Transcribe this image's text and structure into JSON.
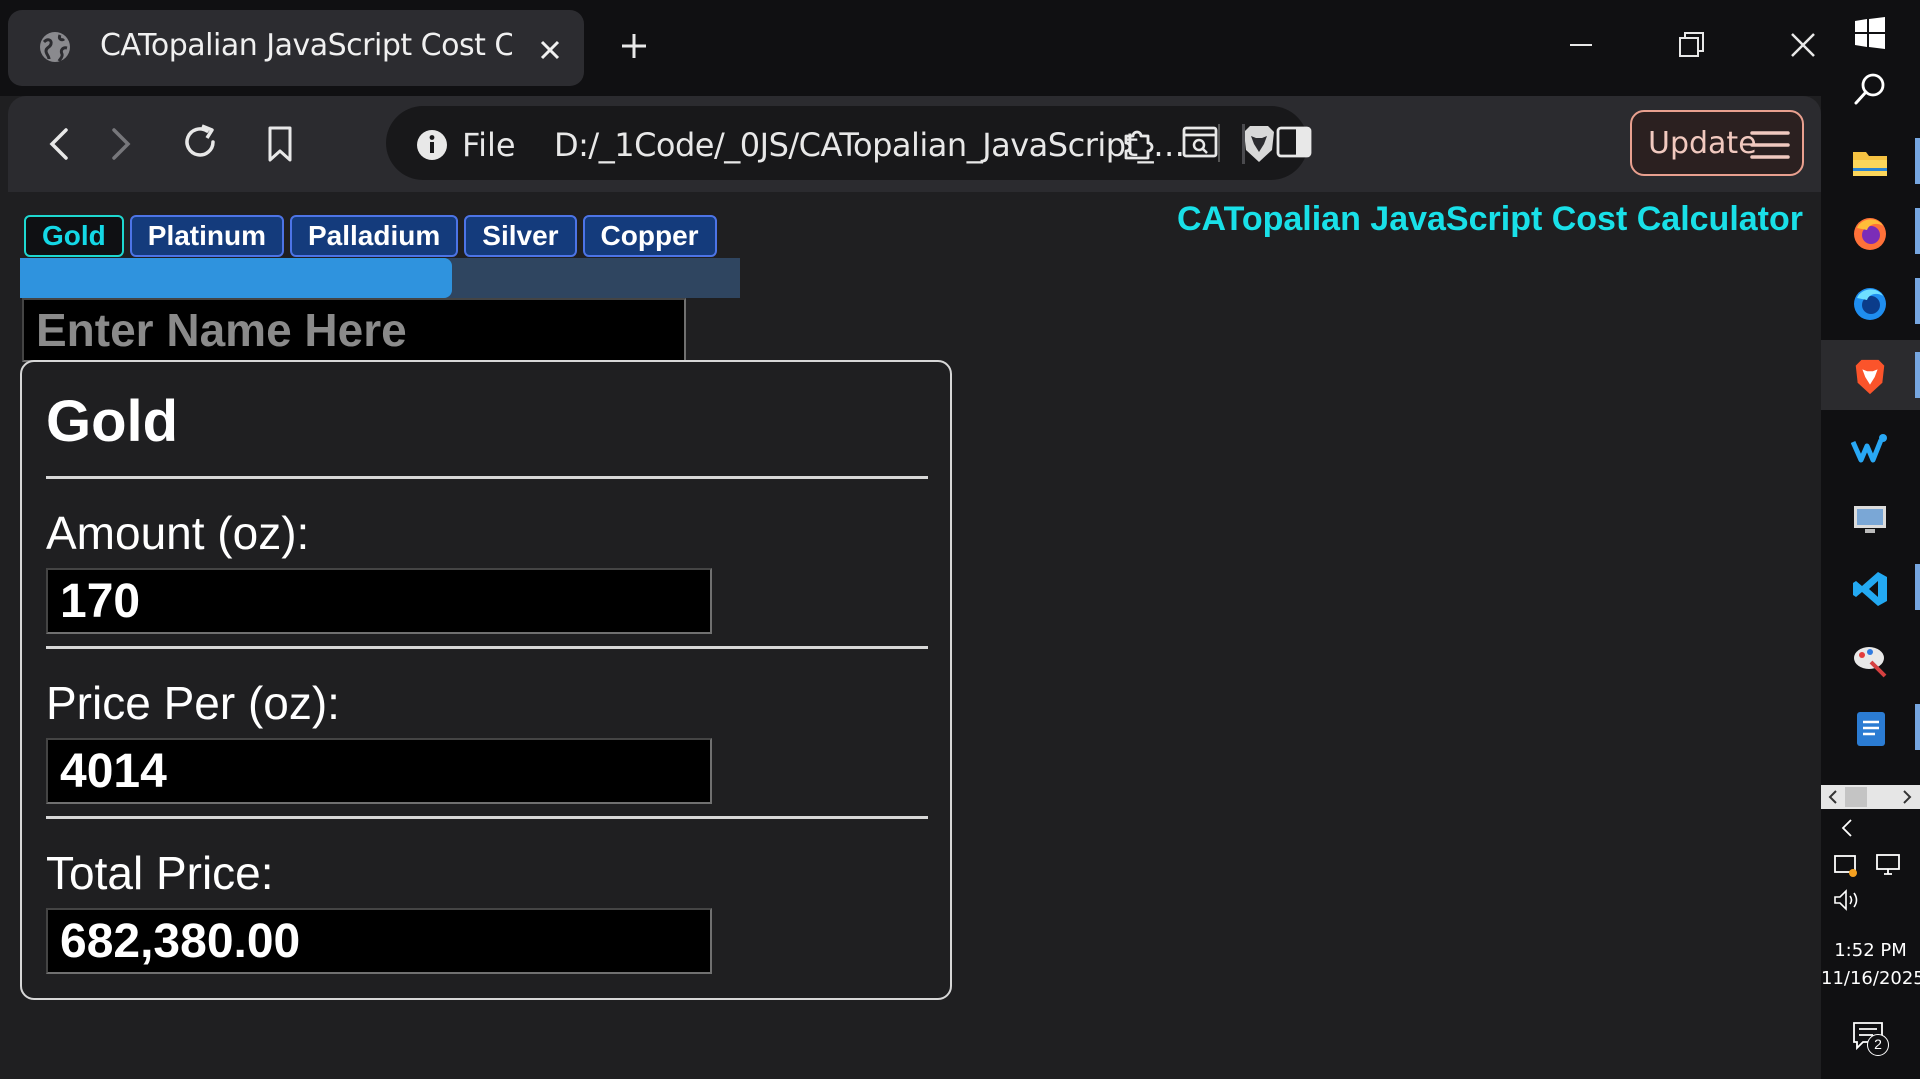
{
  "browser": {
    "tab_title": "CATopalian JavaScript Cost Calcu",
    "address_scheme": "File",
    "address_url": "D:/_1Code/_0JS/CATopalian_JavaScript_C...",
    "update_label": "Update"
  },
  "page": {
    "app_title": "CATopalian JavaScript Cost Calculator",
    "metal_tabs": [
      {
        "label": "Gold",
        "active": true
      },
      {
        "label": "Platinum",
        "active": false
      },
      {
        "label": "Palladium",
        "active": false
      },
      {
        "label": "Silver",
        "active": false
      },
      {
        "label": "Copper",
        "active": false
      }
    ],
    "progress_fraction": 0.6,
    "name_placeholder": "Enter Name Here",
    "card": {
      "metal_name": "Gold",
      "amount_label": "Amount (oz):",
      "amount_value": "170",
      "price_label": "Price Per (oz):",
      "price_value": "4014",
      "total_label": "Total Price:",
      "total_value": "682,380.00"
    }
  },
  "taskbar": {
    "apps": [
      "file-explorer-icon",
      "firefox-icon",
      "firefox-developer-icon",
      "brave-browser-icon",
      "wave-app-icon",
      "monitor-tool-icon",
      "vscode-icon",
      "paint-icon",
      "word-icon"
    ],
    "time": "1:52 PM",
    "date": "11/16/2025",
    "notification_count": "2"
  },
  "colors": {
    "accent_cyan": "#19e0e8",
    "tab_button_blue": "#143b7c",
    "progress_fill": "#2f93de",
    "update_border": "#e9a08f"
  }
}
